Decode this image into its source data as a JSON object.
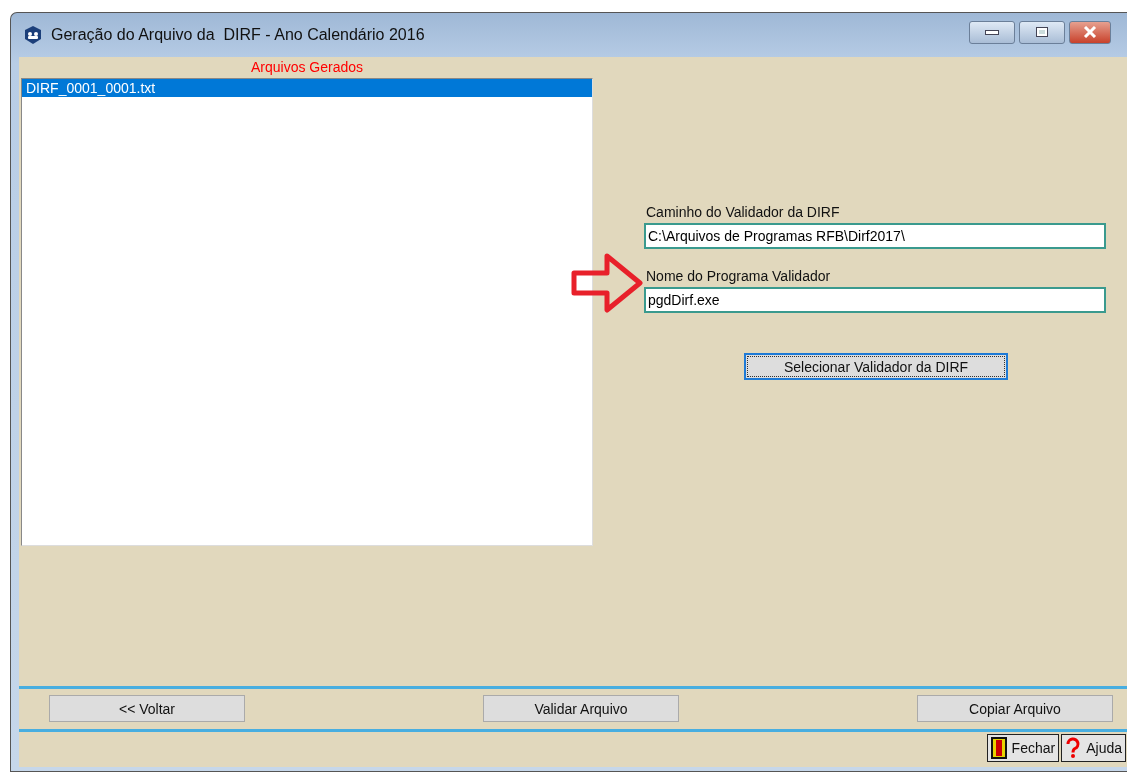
{
  "window": {
    "title": "Geração do Arquivo da  DIRF - Ano Calendário 2016"
  },
  "files": {
    "title": "Arquivos Gerados",
    "items": [
      {
        "label": "DIRF_0001_0001.txt",
        "selected": true
      }
    ]
  },
  "fields": [
    {
      "label": "Caminho do Validador da DIRF",
      "value": "C:\\Arquivos de Programas RFB\\Dirf2017\\",
      "highlighted": false
    },
    {
      "label": "Nome do Programa Validador",
      "value": "pgdDirf.exe",
      "highlighted": true
    }
  ],
  "select_button": {
    "label": "Selecionar Validador da DIRF"
  },
  "actions": [
    "<< Voltar",
    "Validar Arquivo",
    "Copiar Arquivo"
  ],
  "footer": [
    {
      "kind": "exit",
      "label": "Fechar"
    },
    {
      "kind": "help",
      "label": "Ajuda"
    }
  ]
}
